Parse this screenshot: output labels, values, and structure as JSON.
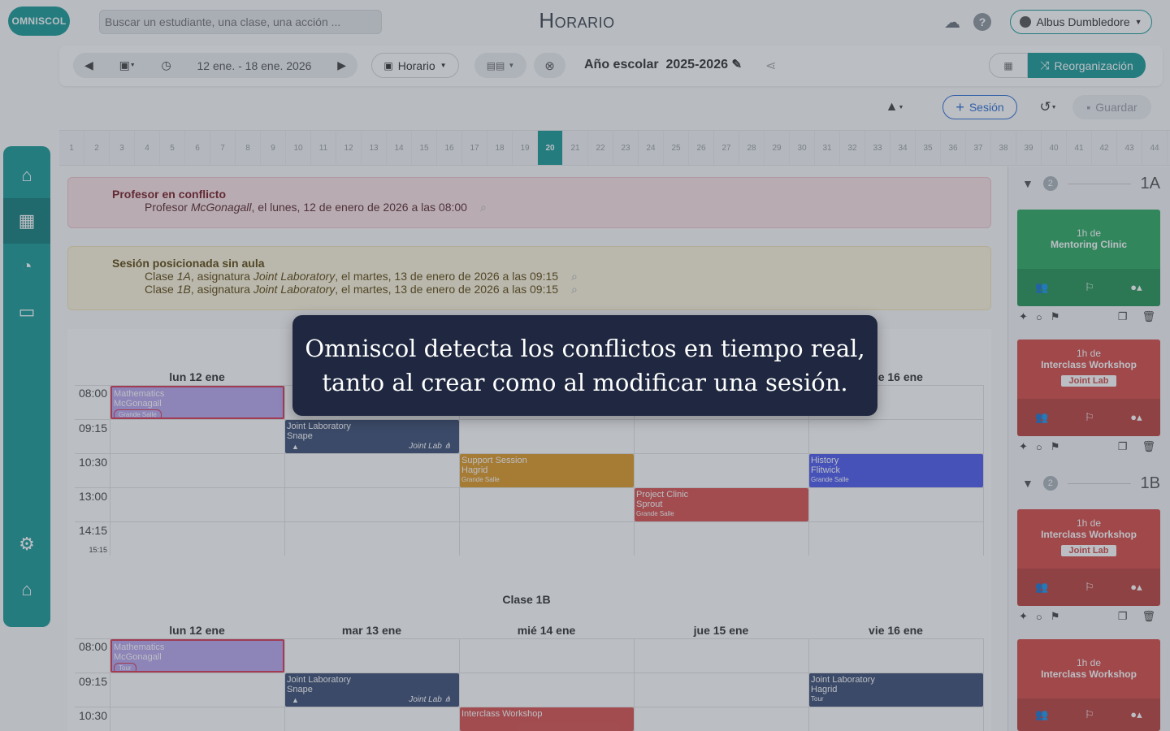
{
  "header": {
    "logo": "OMNISCOL",
    "search_placeholder": "Buscar un estudiante, una clase, una acción ...",
    "title": "Horario",
    "user": "Albus Dumbledore"
  },
  "toolbar": {
    "date_range": "12 ene. - 18 ene. 2026",
    "horario_label": "Horario",
    "year_label": "Año escolar",
    "year_value": "2025-2026",
    "reorg_label": "Reorganización",
    "sesion_label": "Sesión",
    "guardar_label": "Guardar"
  },
  "weeks": {
    "current": 20,
    "count": 44
  },
  "alerts": {
    "conflict": {
      "title": "Profesor en conflicto",
      "line_pre": "Profesor ",
      "line_em": "McGonagall",
      "line_post": ", el lunes, 12 de enero de 2026 a las 08:00"
    },
    "noroom": {
      "title": "Sesión posicionada sin aula",
      "lines": [
        {
          "pre": "Clase ",
          "cls": "1A",
          "mid": ", asignatura ",
          "subj": "Joint Laboratory",
          "post": ", el martes, 13 de enero de 2026 a las 09:15"
        },
        {
          "pre": "Clase ",
          "cls": "1B",
          "mid": ", asignatura ",
          "subj": "Joint Laboratory",
          "post": ", el martes, 13 de enero de 2026 a las 09:15"
        }
      ]
    }
  },
  "calendar": {
    "days": [
      "lun 12 ene",
      "mar 13 ene",
      "mié 14 ene",
      "jue 15 ene",
      "vie 16 ene"
    ],
    "times_a": [
      "08:00",
      "09:15",
      "10:30",
      "13:00",
      "14:15"
    ],
    "end_time_a": "15:15",
    "class_b_label": "Clase 1B",
    "times_b": [
      "08:00",
      "09:15",
      "10:30"
    ],
    "events_a": {
      "math": {
        "title": "Mathematics",
        "teacher": "McGonagall",
        "room": "Grande Salle"
      },
      "jlab": {
        "title": "Joint Laboratory",
        "teacher": "Snape",
        "room": "Joint Lab"
      },
      "support": {
        "title": "Support Session",
        "teacher": "Hagrid",
        "room": "Grande Salle"
      },
      "history": {
        "title": "History",
        "teacher": "Flitwick",
        "room": "Grande Salle"
      },
      "project": {
        "title": "Project Clinic",
        "teacher": "Sprout",
        "room": "Grande Salle"
      }
    },
    "events_b": {
      "math": {
        "title": "Mathematics",
        "teacher": "McGonagall",
        "room": "Tour"
      },
      "jlab": {
        "title": "Joint Laboratory",
        "teacher": "Snape",
        "room": "Joint Lab"
      },
      "jlab2": {
        "title": "Joint Laboratory",
        "teacher": "Hagrid",
        "room": "Tour"
      },
      "inter": {
        "title": "Interclass Workshop"
      }
    }
  },
  "right_panel": {
    "groups": [
      {
        "name": "1A",
        "count": "2"
      },
      {
        "name": "1B",
        "count": "2"
      }
    ],
    "cards": [
      {
        "line1": "1h de",
        "line2": "Mentoring Clinic"
      },
      {
        "line1": "1h de",
        "line2": "Interclass Workshop",
        "chip": "Joint Lab"
      },
      {
        "line1": "1h de",
        "line2": "Interclass Workshop",
        "chip": "Joint Lab"
      },
      {
        "line1": "1h de",
        "line2": "Interclass Workshop"
      }
    ]
  },
  "callout": {
    "line1": "Omniscol detecta los conflictos en tiempo real,",
    "line2": "tanto al crear como al modificar una sesión."
  },
  "colors": {
    "brand": "#1b9c98",
    "conflict_bg": "#fbe3e6",
    "warning_bg": "#fdf6dd",
    "math": "#b9a7ef",
    "jlab": "#3e4f76",
    "support": "#e09a26",
    "history": "#4f5cf0",
    "project": "#d9534f",
    "mentoring": "#2eaa63",
    "workshop": "#d64d48"
  }
}
